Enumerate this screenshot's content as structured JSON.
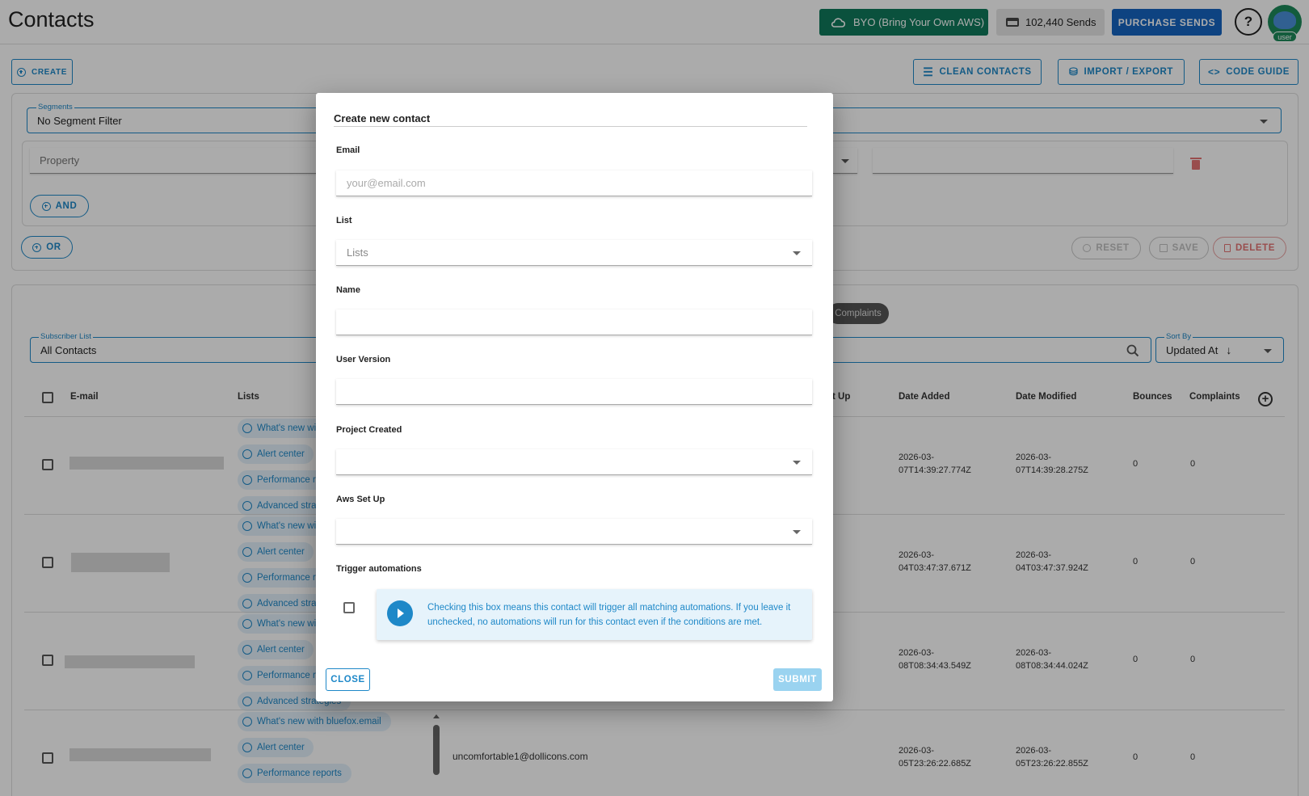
{
  "header": {
    "title": "Contacts",
    "byo_label": "BYO (Bring Your Own AWS)",
    "sends_label": "102,440 Sends",
    "purchase_label": "PURCHASE SENDS",
    "help_label": "?",
    "avatar_badge": "user"
  },
  "toolbar": {
    "create_label": "CREATE",
    "clean_label": "CLEAN CONTACTS",
    "import_label": "IMPORT / EXPORT",
    "code_label": "CODE GUIDE"
  },
  "filters": {
    "segments_label": "Segments",
    "segments_value": "No Segment Filter",
    "property_placeholder": "Property",
    "and_label": "AND",
    "or_label": "OR",
    "reset_label": "RESET",
    "save_label": "SAVE",
    "delete_label": "DELETE"
  },
  "list_controls": {
    "complaints_chip": "Complaints",
    "subscriber_list_label": "Subscriber List",
    "subscriber_list_value": "All Contacts",
    "sort_label": "Sort By",
    "sort_value": "Updated At"
  },
  "table": {
    "headers": {
      "email": "E-mail",
      "lists": "Lists",
      "aws_partial": "t Up",
      "date_added": "Date Added",
      "date_modified": "Date Modified",
      "bounces": "Bounces",
      "complaints": "Complaints"
    },
    "rows": [
      {
        "lists": [
          "What's new wi",
          "Alert center",
          "Performance r",
          "Advanced stra"
        ],
        "date_added": [
          "2026-03-",
          "07T14:39:27.774Z"
        ],
        "date_modified": [
          "2026-03-",
          "07T14:39:28.275Z"
        ],
        "bounces": "0",
        "complaints": "0"
      },
      {
        "lists": [
          "What's new wi",
          "Alert center",
          "Performance r",
          "Advanced stra"
        ],
        "date_added": [
          "2026-03-",
          "04T03:47:37.671Z"
        ],
        "date_modified": [
          "2026-03-",
          "04T03:47:37.924Z"
        ],
        "bounces": "0",
        "complaints": "0"
      },
      {
        "lists": [
          "What's new wi",
          "Alert center",
          "Performance r",
          "Advanced strategies"
        ],
        "date_added": [
          "2026-03-",
          "08T08:34:43.549Z"
        ],
        "date_modified": [
          "2026-03-",
          "08T08:34:44.024Z"
        ],
        "bounces": "0",
        "complaints": "0"
      },
      {
        "lists": [
          "What's new with bluefox.email",
          "Alert center",
          "Performance reports"
        ],
        "email_value": "uncomfortable1@dollicons.com",
        "date_added": [
          "2026-03-",
          "05T23:26:22.685Z"
        ],
        "date_modified": [
          "2026-03-",
          "05T23:26:22.855Z"
        ],
        "bounces": "0",
        "complaints": "0"
      }
    ]
  },
  "dialog": {
    "title": "Create new contact",
    "email_label": "Email",
    "email_placeholder": "your@email.com",
    "list_label": "List",
    "list_placeholder": "Lists",
    "name_label": "Name",
    "user_version_label": "User Version",
    "project_created_label": "Project Created",
    "aws_setup_label": "Aws Set Up",
    "trigger_label": "Trigger automations",
    "trigger_info": "Checking this box means this contact will trigger all matching automations. If you leave it unchecked, no automations will run for this contact even if the conditions are met.",
    "close_label": "CLOSE",
    "submit_label": "SUBMIT"
  },
  "colors": {
    "accent": "#1e88c8",
    "byo_green": "#0f7a5c",
    "purchase_blue": "#1565c0",
    "danger": "#e57373"
  }
}
